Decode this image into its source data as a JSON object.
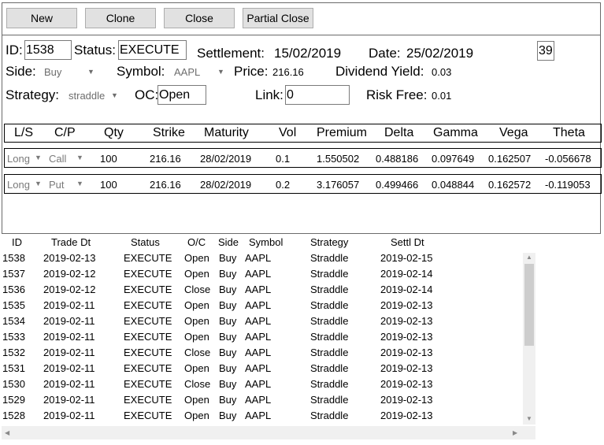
{
  "toolbar": {
    "new_label": "New",
    "clone_label": "Clone",
    "close_label": "Close",
    "partial_close_label": "Partial Close"
  },
  "form": {
    "id_label": "ID:",
    "id_value": "1538",
    "status_label": "Status:",
    "status_value": "EXECUTE",
    "settlement_label": "Settlement:",
    "settlement_value": "15/02/2019",
    "date_label": "Date:",
    "date_value": "25/02/2019",
    "days_value": "39",
    "side_label": "Side:",
    "side_value": "Buy",
    "symbol_label": "Symbol:",
    "symbol_value": "AAPL",
    "price_label": "Price:",
    "price_value": "216.16",
    "dividend_label": "Dividend Yield:",
    "dividend_value": "0.03",
    "strategy_label": "Strategy:",
    "strategy_value": "straddle",
    "oc_label": "OC:",
    "oc_value": "Open",
    "link_label": "Link:",
    "link_value": "0",
    "riskfree_label": "Risk Free:",
    "riskfree_value": "0.01"
  },
  "legs": {
    "columns": [
      "L/S",
      "C/P",
      "Qty",
      "Strike",
      "Maturity",
      "Vol",
      "Premium",
      "Delta",
      "Gamma",
      "Vega",
      "Theta"
    ],
    "rows": [
      {
        "ls": "Long",
        "cp": "Call",
        "qty": "100",
        "strike": "216.16",
        "maturity": "28/02/2019",
        "vol": "0.1",
        "premium": "1.550502",
        "delta": "0.488186",
        "gamma": "0.097649",
        "vega": "0.162507",
        "theta": "-0.056678"
      },
      {
        "ls": "Long",
        "cp": "Put",
        "qty": "100",
        "strike": "216.16",
        "maturity": "28/02/2019",
        "vol": "0.2",
        "premium": "3.176057",
        "delta": "0.499466",
        "gamma": "0.048844",
        "vega": "0.162572",
        "theta": "-0.119053"
      }
    ]
  },
  "trades": {
    "columns": [
      "ID",
      "Trade Dt",
      "Status",
      "O/C",
      "Side",
      "Symbol",
      "Strategy",
      "Settl Dt"
    ],
    "rows": [
      [
        "1538",
        "2019-02-13",
        "EXECUTE",
        "Open",
        "Buy",
        "AAPL",
        "Straddle",
        "2019-02-15"
      ],
      [
        "1537",
        "2019-02-12",
        "EXECUTE",
        "Open",
        "Buy",
        "AAPL",
        "Straddle",
        "2019-02-14"
      ],
      [
        "1536",
        "2019-02-12",
        "EXECUTE",
        "Close",
        "Buy",
        "AAPL",
        "Straddle",
        "2019-02-14"
      ],
      [
        "1535",
        "2019-02-11",
        "EXECUTE",
        "Open",
        "Buy",
        "AAPL",
        "Straddle",
        "2019-02-13"
      ],
      [
        "1534",
        "2019-02-11",
        "EXECUTE",
        "Open",
        "Buy",
        "AAPL",
        "Straddle",
        "2019-02-13"
      ],
      [
        "1533",
        "2019-02-11",
        "EXECUTE",
        "Open",
        "Buy",
        "AAPL",
        "Straddle",
        "2019-02-13"
      ],
      [
        "1532",
        "2019-02-11",
        "EXECUTE",
        "Close",
        "Buy",
        "AAPL",
        "Straddle",
        "2019-02-13"
      ],
      [
        "1531",
        "2019-02-11",
        "EXECUTE",
        "Open",
        "Buy",
        "AAPL",
        "Straddle",
        "2019-02-13"
      ],
      [
        "1530",
        "2019-02-11",
        "EXECUTE",
        "Close",
        "Buy",
        "AAPL",
        "Straddle",
        "2019-02-13"
      ],
      [
        "1529",
        "2019-02-11",
        "EXECUTE",
        "Open",
        "Buy",
        "AAPL",
        "Straddle",
        "2019-02-13"
      ],
      [
        "1528",
        "2019-02-11",
        "EXECUTE",
        "Open",
        "Buy",
        "AAPL",
        "Straddle",
        "2019-02-13"
      ]
    ]
  }
}
